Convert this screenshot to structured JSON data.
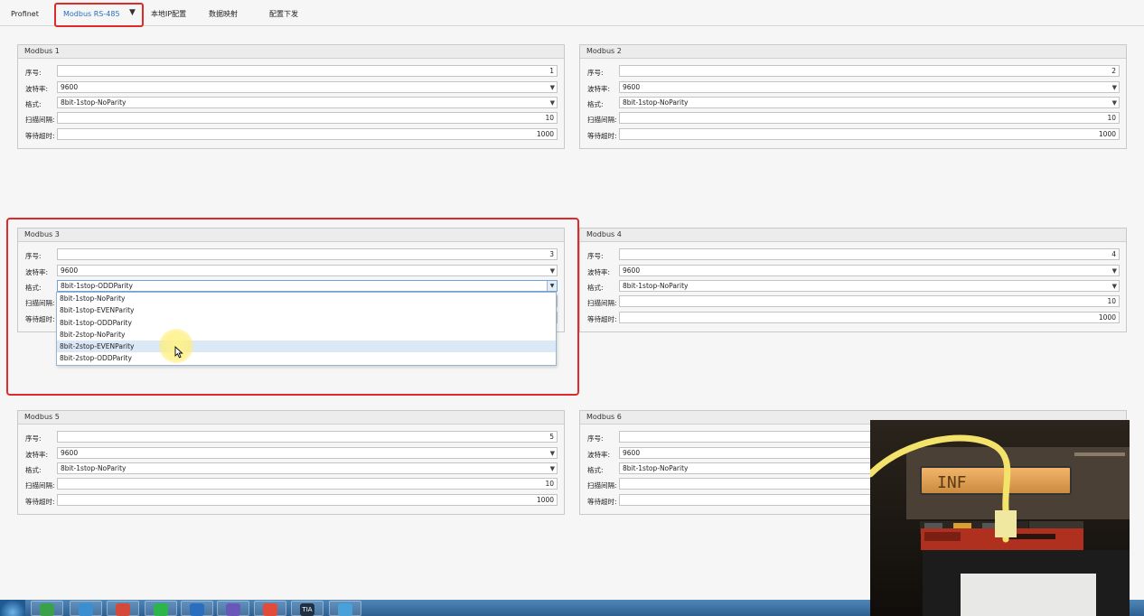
{
  "tabs": [
    {
      "label": "Profinet"
    },
    {
      "label": "Modbus RS-485",
      "caret": "▼"
    },
    {
      "label": "本地IP配置"
    },
    {
      "label": "数据映射"
    },
    {
      "label": "配置下发"
    }
  ],
  "field_labels": {
    "seq": "序号:",
    "baud": "波特率:",
    "format": "格式:",
    "scan": "扫描间隔:",
    "timeout": "等待超时:"
  },
  "groups": [
    {
      "title": "Modbus 1",
      "seq": "1",
      "baud": "9600",
      "format": "8bit-1stop-NoParity",
      "scan": "10",
      "timeout": "1000"
    },
    {
      "title": "Modbus 2",
      "seq": "2",
      "baud": "9600",
      "format": "8bit-1stop-NoParity",
      "scan": "10",
      "timeout": "1000"
    },
    {
      "title": "Modbus 3",
      "seq": "3",
      "baud": "9600",
      "format": "8bit-1stop-ODDParity",
      "scan": "",
      "timeout": ""
    },
    {
      "title": "Modbus 4",
      "seq": "4",
      "baud": "9600",
      "format": "8bit-1stop-NoParity",
      "scan": "10",
      "timeout": "1000"
    },
    {
      "title": "Modbus 5",
      "seq": "5",
      "baud": "9600",
      "format": "8bit-1stop-NoParity",
      "scan": "10",
      "timeout": "1000"
    },
    {
      "title": "Modbus 6",
      "seq": "",
      "baud": "9600",
      "format": "8bit-1stop-NoParity",
      "scan": "",
      "timeout": ""
    }
  ],
  "format_options": [
    "8bit-1stop-NoParity",
    "8bit-1stop-EVENParity",
    "8bit-1stop-ODDParity",
    "8bit-2stop-NoParity",
    "8bit-2stop-EVENParity",
    "8bit-2stop-ODDParity"
  ],
  "hovered_option": "8bit-2stop-EVENParity",
  "video_overlay": {
    "lcd_text": "INF"
  },
  "taskbar": {
    "items": [
      "start-orb-icon",
      "ie-icon",
      "network-icon",
      "chrome-icon",
      "wechat-icon",
      "app-icon",
      "building-icon",
      "wps-icon",
      "tia-icon",
      "remote-icon"
    ],
    "tia_label": "TIA"
  },
  "colors": {
    "highlight": "#e02a2a",
    "active_tab": "#2a6ebd",
    "hover": "#dbe8f6"
  }
}
